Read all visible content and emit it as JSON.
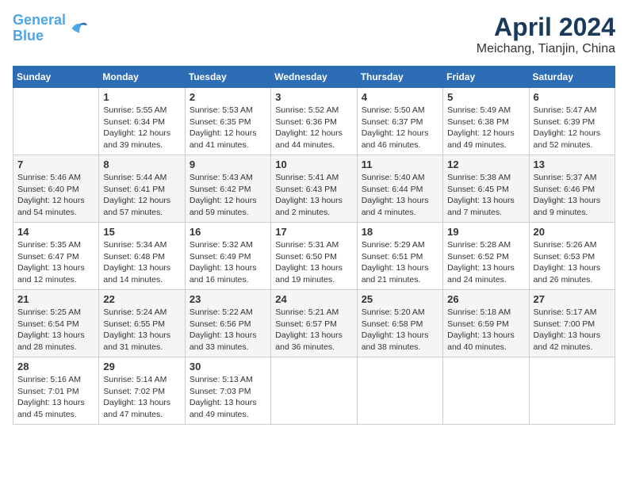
{
  "logo": {
    "line1": "General",
    "line2": "Blue"
  },
  "title": "April 2024",
  "subtitle": "Meichang, Tianjin, China",
  "days_of_week": [
    "Sunday",
    "Monday",
    "Tuesday",
    "Wednesday",
    "Thursday",
    "Friday",
    "Saturday"
  ],
  "weeks": [
    [
      {
        "day": "",
        "info": ""
      },
      {
        "day": "1",
        "info": "Sunrise: 5:55 AM\nSunset: 6:34 PM\nDaylight: 12 hours\nand 39 minutes."
      },
      {
        "day": "2",
        "info": "Sunrise: 5:53 AM\nSunset: 6:35 PM\nDaylight: 12 hours\nand 41 minutes."
      },
      {
        "day": "3",
        "info": "Sunrise: 5:52 AM\nSunset: 6:36 PM\nDaylight: 12 hours\nand 44 minutes."
      },
      {
        "day": "4",
        "info": "Sunrise: 5:50 AM\nSunset: 6:37 PM\nDaylight: 12 hours\nand 46 minutes."
      },
      {
        "day": "5",
        "info": "Sunrise: 5:49 AM\nSunset: 6:38 PM\nDaylight: 12 hours\nand 49 minutes."
      },
      {
        "day": "6",
        "info": "Sunrise: 5:47 AM\nSunset: 6:39 PM\nDaylight: 12 hours\nand 52 minutes."
      }
    ],
    [
      {
        "day": "7",
        "info": "Sunrise: 5:46 AM\nSunset: 6:40 PM\nDaylight: 12 hours\nand 54 minutes."
      },
      {
        "day": "8",
        "info": "Sunrise: 5:44 AM\nSunset: 6:41 PM\nDaylight: 12 hours\nand 57 minutes."
      },
      {
        "day": "9",
        "info": "Sunrise: 5:43 AM\nSunset: 6:42 PM\nDaylight: 12 hours\nand 59 minutes."
      },
      {
        "day": "10",
        "info": "Sunrise: 5:41 AM\nSunset: 6:43 PM\nDaylight: 13 hours\nand 2 minutes."
      },
      {
        "day": "11",
        "info": "Sunrise: 5:40 AM\nSunset: 6:44 PM\nDaylight: 13 hours\nand 4 minutes."
      },
      {
        "day": "12",
        "info": "Sunrise: 5:38 AM\nSunset: 6:45 PM\nDaylight: 13 hours\nand 7 minutes."
      },
      {
        "day": "13",
        "info": "Sunrise: 5:37 AM\nSunset: 6:46 PM\nDaylight: 13 hours\nand 9 minutes."
      }
    ],
    [
      {
        "day": "14",
        "info": "Sunrise: 5:35 AM\nSunset: 6:47 PM\nDaylight: 13 hours\nand 12 minutes."
      },
      {
        "day": "15",
        "info": "Sunrise: 5:34 AM\nSunset: 6:48 PM\nDaylight: 13 hours\nand 14 minutes."
      },
      {
        "day": "16",
        "info": "Sunrise: 5:32 AM\nSunset: 6:49 PM\nDaylight: 13 hours\nand 16 minutes."
      },
      {
        "day": "17",
        "info": "Sunrise: 5:31 AM\nSunset: 6:50 PM\nDaylight: 13 hours\nand 19 minutes."
      },
      {
        "day": "18",
        "info": "Sunrise: 5:29 AM\nSunset: 6:51 PM\nDaylight: 13 hours\nand 21 minutes."
      },
      {
        "day": "19",
        "info": "Sunrise: 5:28 AM\nSunset: 6:52 PM\nDaylight: 13 hours\nand 24 minutes."
      },
      {
        "day": "20",
        "info": "Sunrise: 5:26 AM\nSunset: 6:53 PM\nDaylight: 13 hours\nand 26 minutes."
      }
    ],
    [
      {
        "day": "21",
        "info": "Sunrise: 5:25 AM\nSunset: 6:54 PM\nDaylight: 13 hours\nand 28 minutes."
      },
      {
        "day": "22",
        "info": "Sunrise: 5:24 AM\nSunset: 6:55 PM\nDaylight: 13 hours\nand 31 minutes."
      },
      {
        "day": "23",
        "info": "Sunrise: 5:22 AM\nSunset: 6:56 PM\nDaylight: 13 hours\nand 33 minutes."
      },
      {
        "day": "24",
        "info": "Sunrise: 5:21 AM\nSunset: 6:57 PM\nDaylight: 13 hours\nand 36 minutes."
      },
      {
        "day": "25",
        "info": "Sunrise: 5:20 AM\nSunset: 6:58 PM\nDaylight: 13 hours\nand 38 minutes."
      },
      {
        "day": "26",
        "info": "Sunrise: 5:18 AM\nSunset: 6:59 PM\nDaylight: 13 hours\nand 40 minutes."
      },
      {
        "day": "27",
        "info": "Sunrise: 5:17 AM\nSunset: 7:00 PM\nDaylight: 13 hours\nand 42 minutes."
      }
    ],
    [
      {
        "day": "28",
        "info": "Sunrise: 5:16 AM\nSunset: 7:01 PM\nDaylight: 13 hours\nand 45 minutes."
      },
      {
        "day": "29",
        "info": "Sunrise: 5:14 AM\nSunset: 7:02 PM\nDaylight: 13 hours\nand 47 minutes."
      },
      {
        "day": "30",
        "info": "Sunrise: 5:13 AM\nSunset: 7:03 PM\nDaylight: 13 hours\nand 49 minutes."
      },
      {
        "day": "",
        "info": ""
      },
      {
        "day": "",
        "info": ""
      },
      {
        "day": "",
        "info": ""
      },
      {
        "day": "",
        "info": ""
      }
    ]
  ]
}
